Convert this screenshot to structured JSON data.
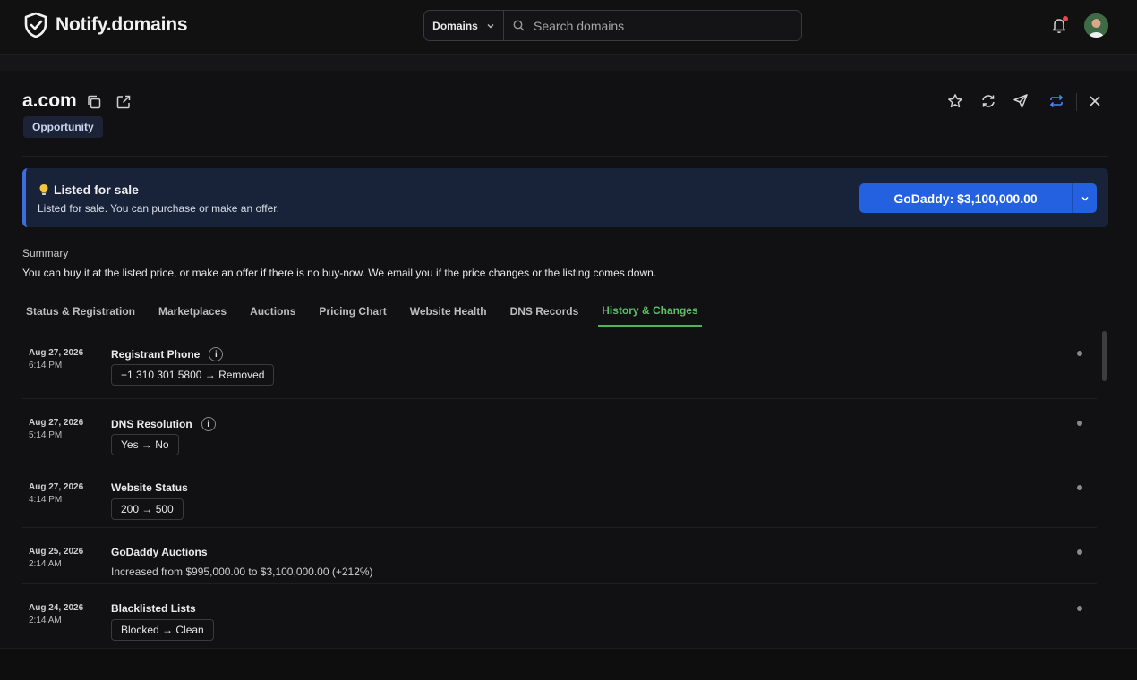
{
  "app": {
    "name": "Notify.domains"
  },
  "search": {
    "scope": "Domains",
    "placeholder": "Search domains"
  },
  "domain": {
    "name": "a.com",
    "badge": "Opportunity"
  },
  "alert": {
    "icon": "lightbulb-icon",
    "title": "Listed for sale",
    "description": "Listed for sale. You can purchase or make an offer.",
    "button_label": "GoDaddy: $3,100,000.00"
  },
  "summary": {
    "label": "Summary",
    "text": "You can buy it at the listed price, or make an offer if there is no buy-now. We email you if the price changes or the listing comes down."
  },
  "tabs": [
    {
      "label": "Status & Registration",
      "active": false
    },
    {
      "label": "Marketplaces",
      "active": false
    },
    {
      "label": "Auctions",
      "active": false
    },
    {
      "label": "Pricing Chart",
      "active": false
    },
    {
      "label": "Website Health",
      "active": false
    },
    {
      "label": "DNS Records",
      "active": false
    },
    {
      "label": "History & Changes",
      "active": true
    }
  ],
  "history": [
    {
      "date": "Aug 27, 2026",
      "time": "6:14 PM",
      "title": "Registrant Phone",
      "info": "i",
      "change": "+1 310 301 5800 → Removed"
    },
    {
      "date": "Aug 27, 2026",
      "time": "5:14 PM",
      "title": "DNS Resolution",
      "info": "i",
      "change": "Yes → No"
    },
    {
      "date": "Aug 27, 2026",
      "time": "4:14 PM",
      "title": "Website Status",
      "change": "200 → 500"
    },
    {
      "date": "Aug 25, 2026",
      "time": "2:14 AM",
      "title": "GoDaddy Auctions",
      "description": "Increased from $995,000.00 to $3,100,000.00 (+212%)"
    },
    {
      "date": "Aug 24, 2026",
      "time": "2:14 AM",
      "title": "Blacklisted Lists",
      "change": "Blocked → Clean"
    }
  ],
  "colors": {
    "accent_blue": "#2461e0",
    "active_tab": "#5fbf6b",
    "notification": "#e5484d"
  }
}
